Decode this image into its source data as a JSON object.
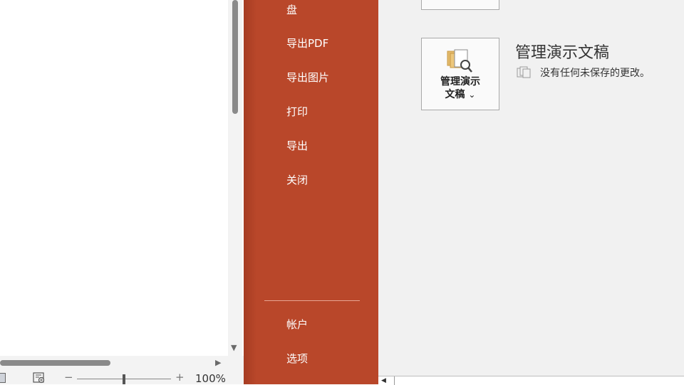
{
  "nav": {
    "partial_item": "盘",
    "export_pdf": "导出PDF",
    "export_image": "导出图片",
    "print": "打印",
    "export": "导出",
    "close": "关闭",
    "account": "帐户",
    "options": "选项"
  },
  "manage": {
    "tile_label_line1": "管理演示",
    "tile_label_line2": "文稿",
    "dropdown_glyph": "⌄",
    "title": "管理演示文稿",
    "status": "没有任何未保存的更改。"
  },
  "statusbar": {
    "zoom_minus": "−",
    "zoom_plus": "+",
    "zoom_level": "100%",
    "zoom_fraction": 0.5
  },
  "scrollbar": {
    "down_arrow": "▼",
    "right_arrow": "▶",
    "left_arrow": "◀"
  },
  "colors": {
    "backstage_nav": "#b9472a",
    "content_bg": "#f1f1f1"
  }
}
